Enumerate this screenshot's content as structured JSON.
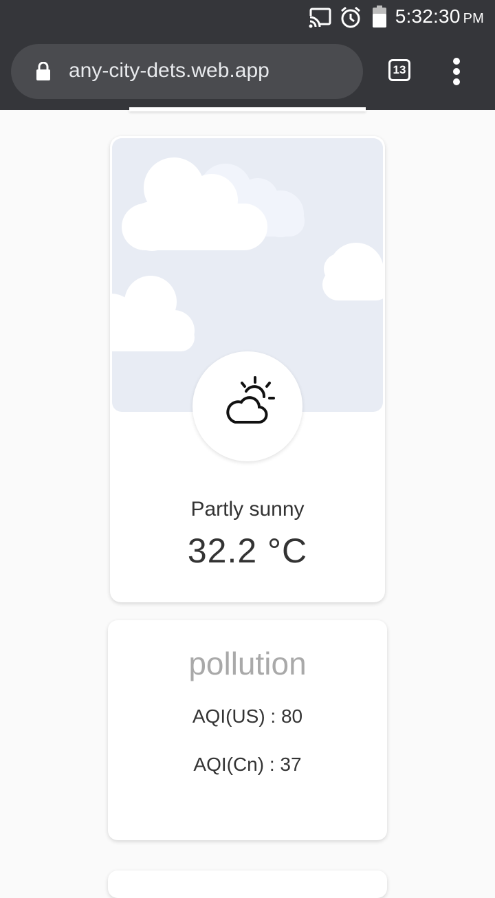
{
  "status_bar": {
    "time": "5:32:30",
    "ampm": "PM",
    "icons": [
      "cast-icon",
      "alarm-icon",
      "battery-icon"
    ]
  },
  "browser": {
    "url": "any-city-dets.web.app",
    "tab_count": "13",
    "icons": [
      "lock-icon",
      "overflow-menu-icon"
    ]
  },
  "weather": {
    "condition": "Partly sunny",
    "temperature": "32.2 °C",
    "icon": "partly-sunny-icon"
  },
  "pollution": {
    "title": "pollution",
    "aqi_us": "AQI(US) : 80",
    "aqi_cn": "AQI(Cn) : 37"
  },
  "colors": {
    "toolbar": "#35363a",
    "omnibox": "#4a4b4f",
    "sky": "#e8ecf4",
    "page_background": "#fafafa"
  }
}
